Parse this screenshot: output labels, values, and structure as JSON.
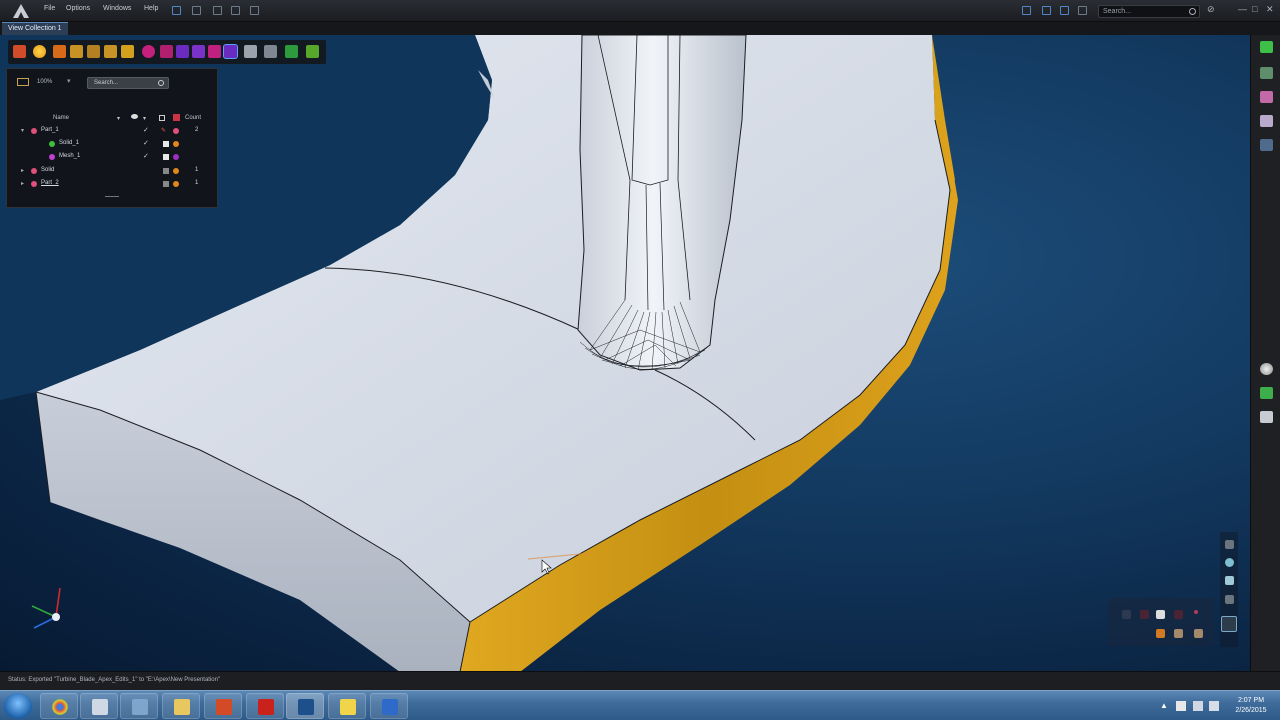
{
  "menu": {
    "items": [
      "File",
      "Options",
      "Windows",
      "Help"
    ],
    "search_placeholder": "Search...",
    "window_controls": [
      "—",
      "□",
      "✕"
    ]
  },
  "tabs": {
    "active": "View Collection 1"
  },
  "browser": {
    "zoom": "100%",
    "search_placeholder": "Search...",
    "column_name": "Name",
    "column_count": "Count",
    "rows": [
      {
        "label": "Part_1",
        "count": "2",
        "check": "✓",
        "color": "#e0507a"
      },
      {
        "label": "Solid_1",
        "count": "",
        "check": "✓",
        "color": "#3cbf3c"
      },
      {
        "label": "Mesh_1",
        "count": "",
        "check": "✓",
        "color": "#c040d0"
      },
      {
        "label": "Solid",
        "count": "1",
        "check": "",
        "color": "#e0507a"
      },
      {
        "label": "Part_2",
        "count": "1",
        "check": "",
        "color": "#e0507a"
      }
    ]
  },
  "status": {
    "text": "Status:  Exported \"Turbine_Blade_Apex_Edits_1\" to \"E:\\Apex\\New Presentation\""
  },
  "taskbar": {
    "time": "2:07 PM",
    "date": "2/26/2015"
  },
  "colors": {
    "accent_yellow": "#d9a21b",
    "model_face": "#d7dde8",
    "viewport_bg": "#133a61"
  }
}
